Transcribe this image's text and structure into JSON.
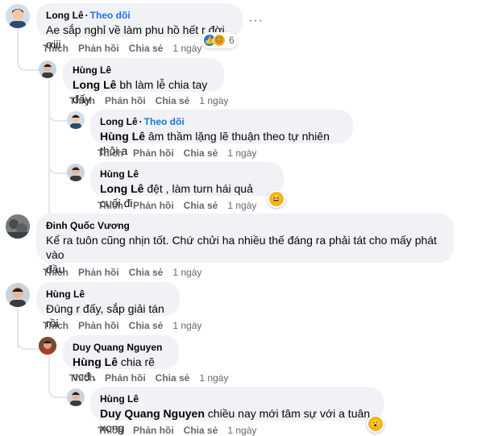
{
  "labels": {
    "like": "Thích",
    "reply": "Phản hồi",
    "share": "Chia sẻ",
    "follow": "Theo dõi",
    "dot": "·"
  },
  "comments": [
    {
      "author": "Long Lê",
      "text": "Ae sắp nghỉ về làm phu hồ hết r đời ơiii",
      "time": "1 ngày",
      "reaction_count": "6",
      "reactions": [
        "like-icon",
        "sad-icon"
      ]
    },
    {
      "author": "Hùng Lê",
      "mention": "Long Lê",
      "text": " bh làm lễ chia tay đấy",
      "time": "1 ngày"
    },
    {
      "author": "Long Lê",
      "mention": "Hùng Lê",
      "text": " âm thầm lặng lẽ thuận theo tự nhiên thôi a",
      "time": "1 ngày"
    },
    {
      "author": "Hùng Lê",
      "mention": "Long Lê",
      "text": " đệt , làm turn hái quả cuối đi",
      "time": "1 ngày",
      "reactions": [
        "haha-icon"
      ]
    },
    {
      "author": "Đinh Quốc Vương",
      "text_line1": "Kể ra tuôn cũng nhịn tốt. Chứ chửi ha nhiều thế đáng ra phải tát cho mấy phát vào",
      "text_line2": "đầu",
      "time": "1 ngày"
    },
    {
      "author": "Hùng Lê",
      "text": "Đúng r đấy, sắp giải tán rồi",
      "time": "1 ngày"
    },
    {
      "author": "Duy Quang Nguyen",
      "mention": "Hùng Lê",
      "text": " chia rẽ vcđ .",
      "time": "1 ngày"
    },
    {
      "author": "Hùng Lê",
      "mention": "Duy Quang Nguyen",
      "text": " chiều nay mới tâm sự với a tuân xong",
      "time": "1 ngày",
      "reactions": [
        "wow-icon"
      ]
    }
  ],
  "colors": {
    "bubble": "#f0f2f5",
    "follow": "#1b74e4",
    "meta": "#65676b"
  }
}
